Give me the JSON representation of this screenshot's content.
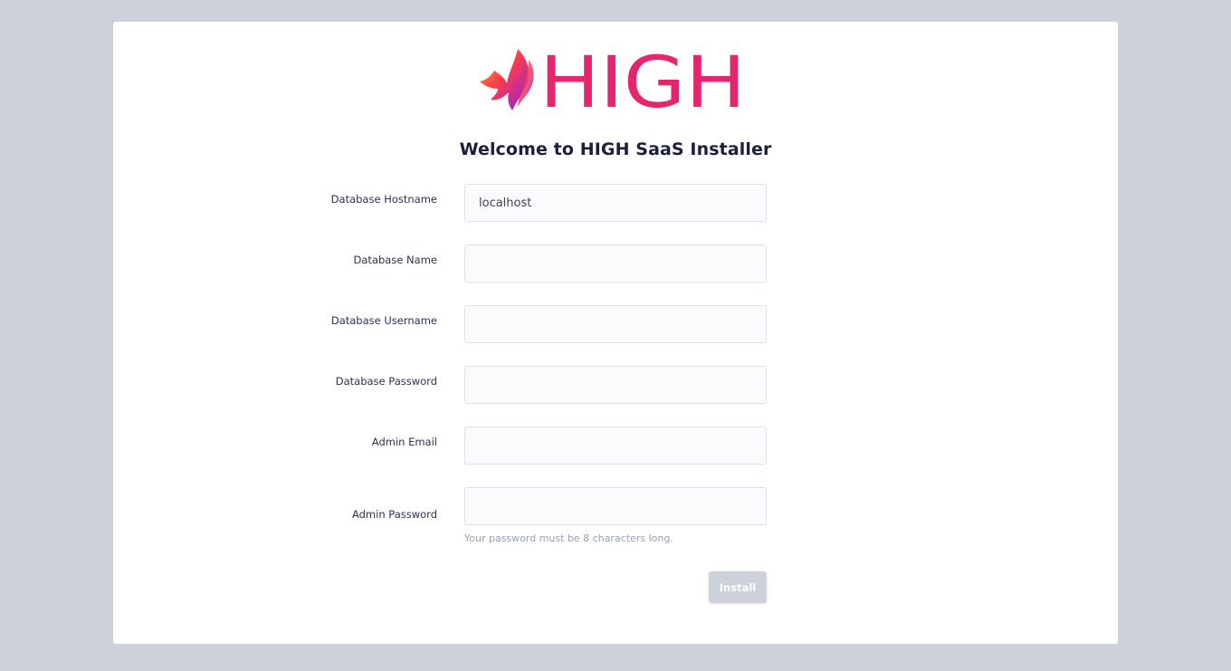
{
  "brand": {
    "name": "HIGH",
    "logo_color": "#e6256f"
  },
  "page": {
    "title": "Welcome to HIGH SaaS Installer"
  },
  "form": {
    "fields": [
      {
        "label": "Database Hostname",
        "value": "localhost",
        "placeholder": ""
      },
      {
        "label": "Database Name",
        "value": "",
        "placeholder": ""
      },
      {
        "label": "Database Username",
        "value": "",
        "placeholder": ""
      },
      {
        "label": "Database Password",
        "value": "",
        "placeholder": ""
      },
      {
        "label": "Admin Email",
        "value": "",
        "placeholder": ""
      },
      {
        "label": "Admin Password",
        "value": "",
        "placeholder": ""
      }
    ],
    "password_hint": "Your password must be 8 characters long.",
    "submit_label": "Install"
  },
  "colors": {
    "background": "#cdd2da",
    "card": "#ffffff",
    "brand_pink": "#e6256f",
    "button_disabled": "#cdd2da"
  }
}
